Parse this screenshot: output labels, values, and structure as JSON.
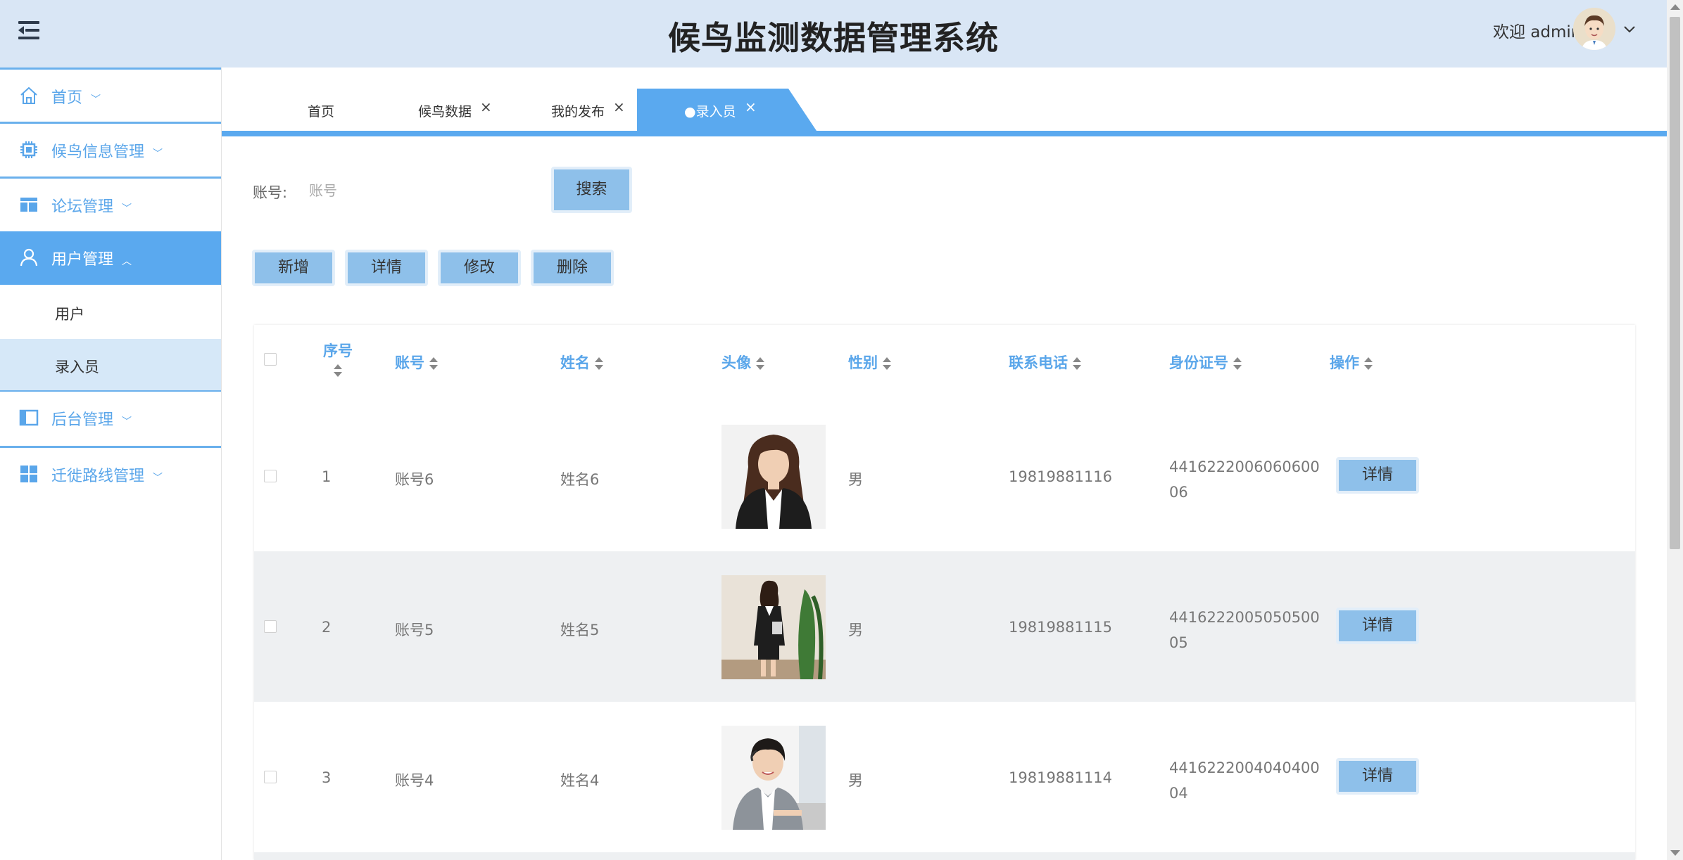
{
  "header": {
    "title": "候鸟监测数据管理系统",
    "welcome": "欢迎 admin"
  },
  "sidebar": {
    "items": [
      {
        "label": "首页",
        "icon": "home-icon",
        "chevron": "﹀"
      },
      {
        "label": "候鸟信息管理",
        "icon": "chip-icon",
        "chevron": "﹀"
      },
      {
        "label": "论坛管理",
        "icon": "layout-icon",
        "chevron": "﹀"
      },
      {
        "label": "用户管理",
        "icon": "user-icon",
        "chevron": "︿"
      },
      {
        "label": "后台管理",
        "icon": "panel-icon",
        "chevron": "﹀"
      },
      {
        "label": "迁徙路线管理",
        "icon": "grid-icon",
        "chevron": "﹀"
      }
    ],
    "subitems": [
      {
        "label": "用户"
      },
      {
        "label": "录入员"
      }
    ]
  },
  "tabs": [
    {
      "label": "首页"
    },
    {
      "label": "候鸟数据"
    },
    {
      "label": "我的发布"
    },
    {
      "label": "●录入员"
    }
  ],
  "search": {
    "label": "账号:",
    "placeholder": "账号",
    "button": "搜索"
  },
  "actions": {
    "add": "新增",
    "detail": "详情",
    "edit": "修改",
    "delete": "删除"
  },
  "table": {
    "headers": [
      "序号",
      "账号",
      "姓名",
      "头像",
      "性别",
      "联系电话",
      "身份证号",
      "操作"
    ],
    "rows": [
      {
        "index": "1",
        "account": "账号6",
        "name": "姓名6",
        "gender": "男",
        "phone": "19819881116",
        "id_line1": "4416222006060600",
        "id_line2": "06",
        "action": "详情"
      },
      {
        "index": "2",
        "account": "账号5",
        "name": "姓名5",
        "gender": "男",
        "phone": "19819881115",
        "id_line1": "4416222005050500",
        "id_line2": "05",
        "action": "详情"
      },
      {
        "index": "3",
        "account": "账号4",
        "name": "姓名4",
        "gender": "男",
        "phone": "19819881114",
        "id_line1": "4416222004040400",
        "id_line2": "04",
        "action": "详情"
      }
    ]
  },
  "colors": {
    "accent": "#5aa9ef",
    "header_bg": "#d9e6f5",
    "button_bg": "#8ec0ea",
    "header_text": "#5aa6ea"
  }
}
